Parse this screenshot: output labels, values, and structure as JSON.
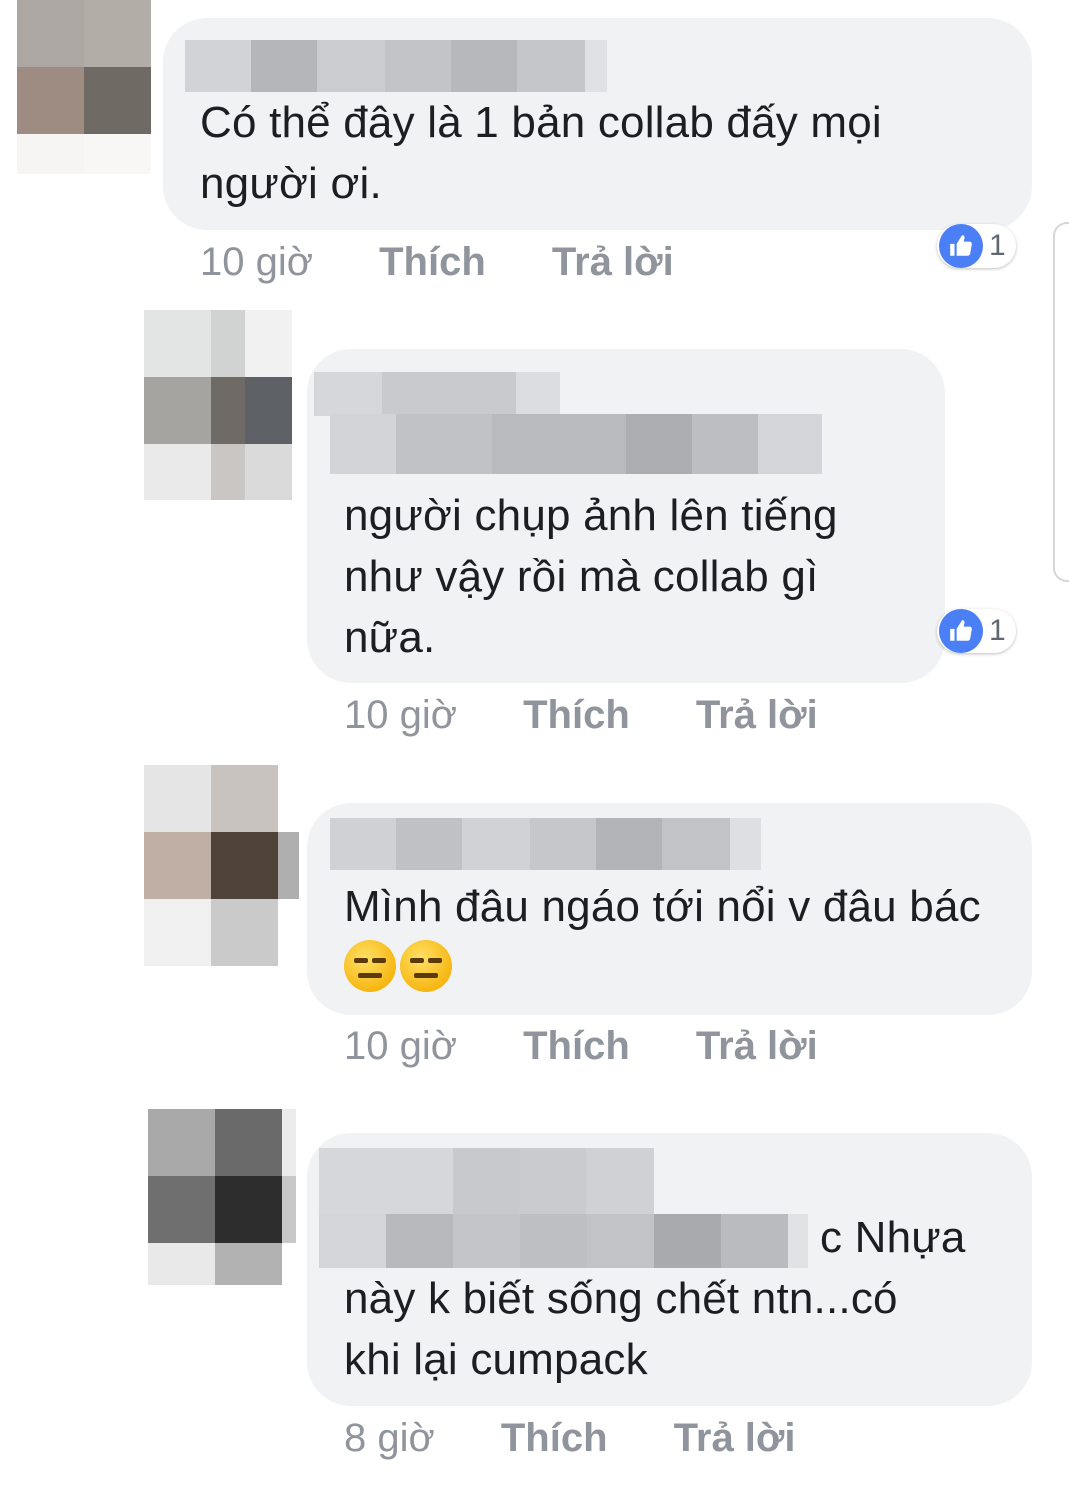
{
  "comments": [
    {
      "text": "Có thể đây là 1 bản collab đấy mọi người ơi.",
      "time": "10 giờ",
      "like_label": "Thích",
      "reply_label": "Trả lời",
      "reaction_count": "1"
    },
    {
      "text": "người chụp ảnh lên tiếng như vậy rồi mà collab gì nữa.",
      "time": "10 giờ",
      "like_label": "Thích",
      "reply_label": "Trả lời",
      "reaction_count": "1"
    },
    {
      "text": "Mình đâu ngáo tới nổi v đâu bác",
      "emoji": [
        "expressionless-face-icon",
        "expressionless-face-icon"
      ],
      "time": "10 giờ",
      "like_label": "Thích",
      "reply_label": "Trả lời"
    },
    {
      "text_line1_tail": "c Nhựa",
      "text_rest": "này k biết sống chết ntn...có khi lại cumpack",
      "time": "8 giờ",
      "like_label": "Thích",
      "reply_label": "Trả lời"
    }
  ],
  "colors": {
    "bubble": "#f1f2f4",
    "meta_text": "#90949c",
    "like_badge": "#4a7ff5"
  }
}
